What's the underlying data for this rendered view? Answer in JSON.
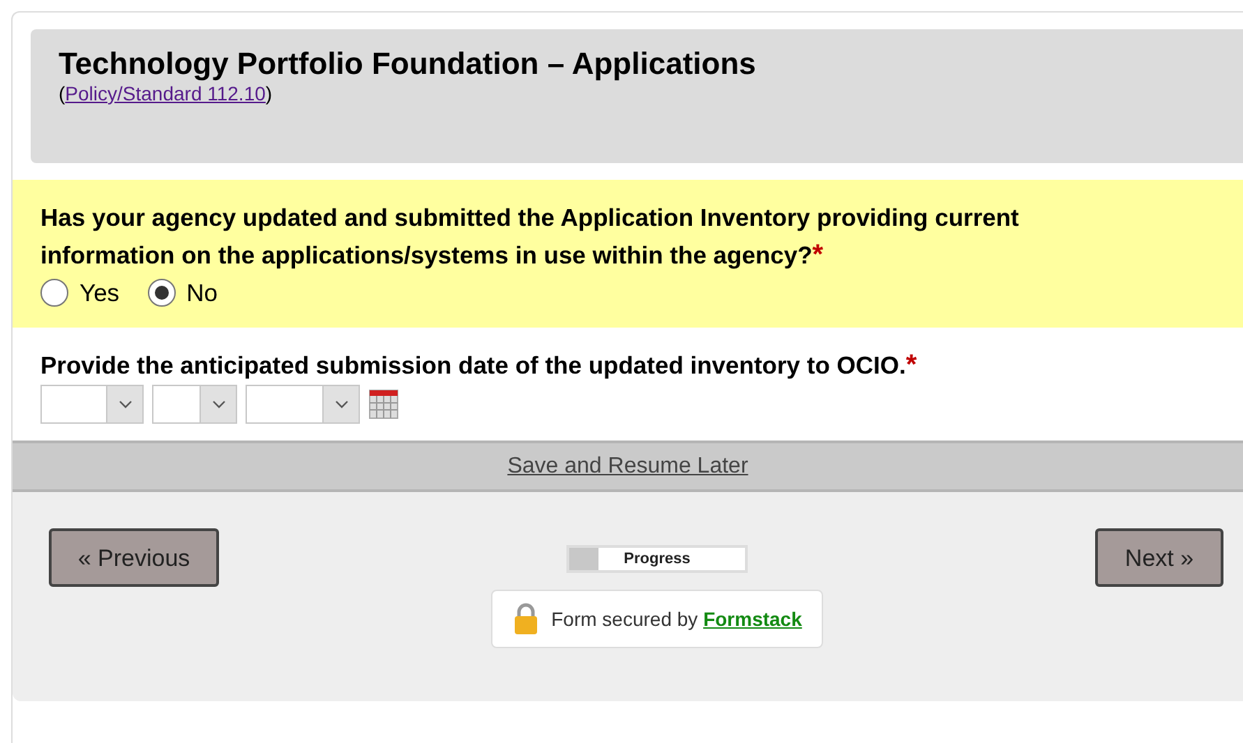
{
  "header": {
    "title": "Technology Portfolio Foundation – Applications",
    "reference": {
      "open": "(",
      "link": "Policy/Standard 112.10",
      "close": ")"
    }
  },
  "questions": [
    {
      "kind": "radio",
      "highlighted": true,
      "label": "Has your agency updated and submitted the Application Inventory providing current information on the applications/systems in use within the agency?",
      "required_mark": "*",
      "options": [
        {
          "label": "Yes",
          "selected": false
        },
        {
          "label": "No",
          "selected": true
        }
      ]
    },
    {
      "kind": "date",
      "highlighted": false,
      "label": "Provide the anticipated submission date of the updated inventory to OCIO.",
      "required_mark": "*"
    }
  ],
  "save_link": "Save and Resume Later",
  "buttons": {
    "previous": "« Previous",
    "next": "Next »"
  },
  "progress": {
    "label": "Progress",
    "level": 0.17
  },
  "security": {
    "text": "Form secured by",
    "link": "Formstack"
  }
}
